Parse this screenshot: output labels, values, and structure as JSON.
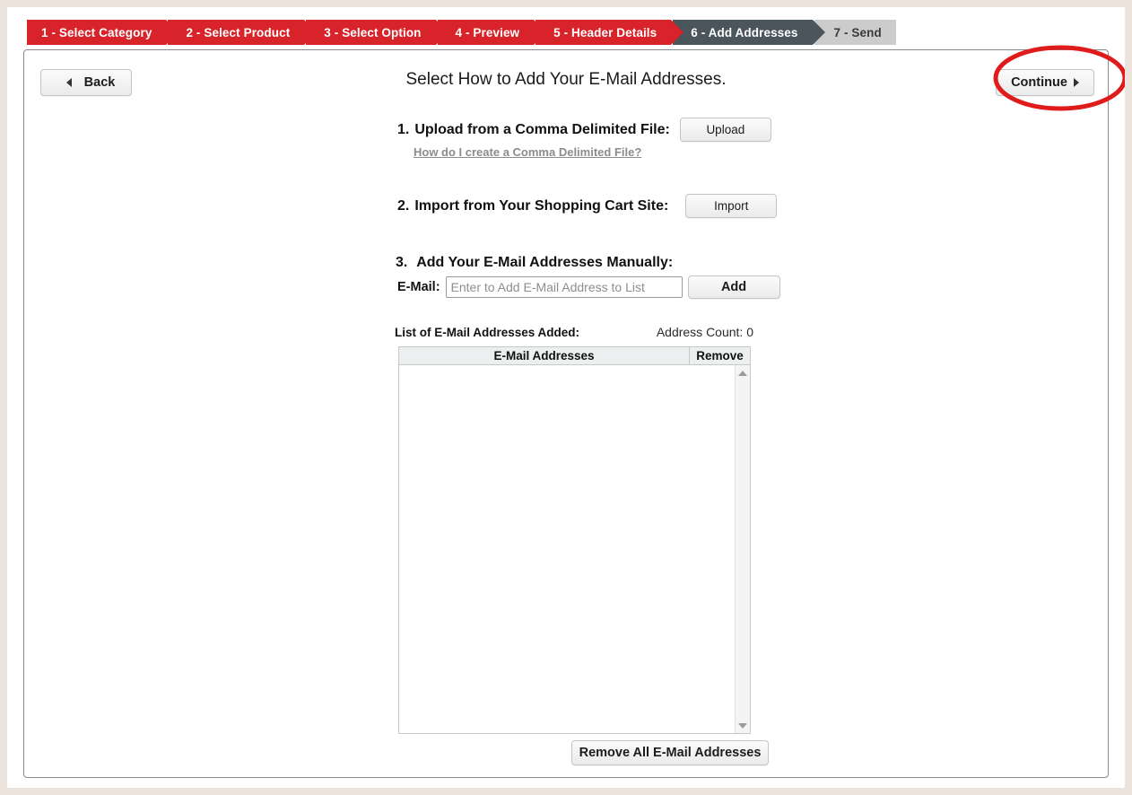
{
  "wizard": {
    "steps": [
      {
        "label": "1 - Select Category",
        "state": "done"
      },
      {
        "label": "2 - Select Product",
        "state": "done"
      },
      {
        "label": "3 - Select Option",
        "state": "done"
      },
      {
        "label": "4 - Preview",
        "state": "done"
      },
      {
        "label": "5 - Header Details",
        "state": "done"
      },
      {
        "label": "6 - Add Addresses",
        "state": "active"
      },
      {
        "label": "7 - Send",
        "state": "todo"
      }
    ],
    "colors": {
      "done": "#d8232a",
      "active": "#4a565c",
      "todo": "#cccccc"
    }
  },
  "toolbar": {
    "back_label": "Back",
    "continue_label": "Continue"
  },
  "page_title": "Select How to Add Your E-Mail Addresses.",
  "options": {
    "option1": {
      "number": "1.",
      "label": "Upload from a Comma Delimited File:",
      "button_label": "Upload",
      "help_link": "How do I create a Comma Delimited File?"
    },
    "option2": {
      "number": "2.",
      "label": "Import from Your Shopping Cart Site:",
      "button_label": "Import"
    },
    "option3": {
      "number": "3.",
      "label": "Add Your E-Mail Addresses Manually:",
      "email_field_label": "E-Mail:",
      "email_placeholder": "Enter to Add E-Mail Address to List",
      "email_value": "",
      "button_label": "Add"
    }
  },
  "list": {
    "caption": "List of E-Mail Addresses Added:",
    "address_count_text": "Address Count: 0",
    "columns": [
      "E-Mail Addresses",
      "Remove"
    ],
    "rows": [],
    "remove_all_label": "Remove All E-Mail Addresses"
  },
  "annotation": {
    "shape": "ellipse",
    "color": "#e01b1b",
    "target": "continue-button"
  }
}
